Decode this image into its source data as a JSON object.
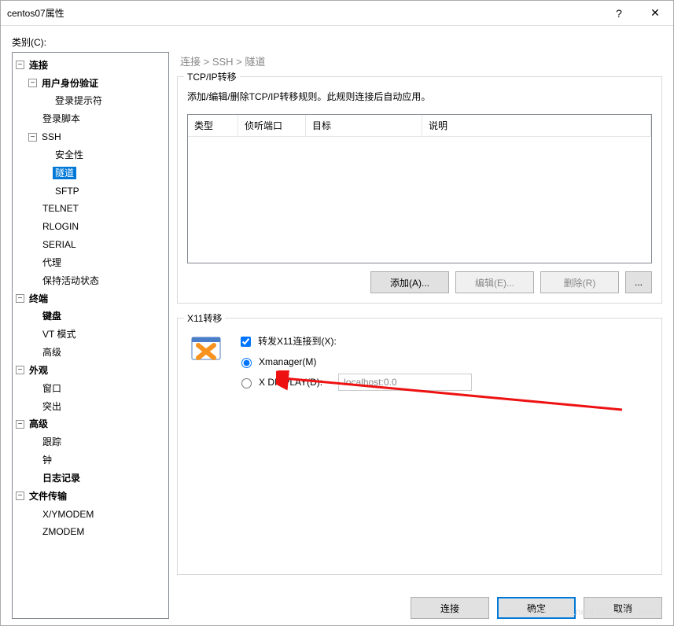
{
  "window": {
    "title": "centos07属性",
    "help": "?",
    "close": "✕"
  },
  "category_label": "类别(C):",
  "tree": {
    "connection": "连接",
    "auth": "用户身份验证",
    "login_prompt": "登录提示符",
    "login_script": "登录脚本",
    "ssh": "SSH",
    "security": "安全性",
    "tunnel": "隧道",
    "sftp": "SFTP",
    "telnet": "TELNET",
    "rlogin": "RLOGIN",
    "serial": "SERIAL",
    "proxy": "代理",
    "keepalive": "保持活动状态",
    "terminal": "终端",
    "keyboard": "键盘",
    "vtmode": "VT 模式",
    "term_adv": "高级",
    "appearance": "外观",
    "window": "窗口",
    "highlight": "突出",
    "advanced": "高级",
    "trace": "跟踪",
    "bell": "钟",
    "logging": "日志记录",
    "filetransfer": "文件传输",
    "xymodem": "X/YMODEM",
    "zmodem": "ZMODEM"
  },
  "breadcrumb": "连接  >  SSH  >  隧道",
  "tcpip": {
    "title": "TCP/IP转移",
    "desc": "添加/编辑/删除TCP/IP转移规则。此规则连接后自动应用。",
    "cols": {
      "type": "类型",
      "port": "侦听端口",
      "target": "目标",
      "desc": "说明"
    },
    "add": "添加(A)...",
    "edit": "编辑(E)...",
    "remove": "删除(R)",
    "more": "..."
  },
  "x11": {
    "title": "X11转移",
    "forward": "转发X11连接到(X):",
    "xmanager": "Xmanager(M)",
    "xdisplay": "X DISPLAY(D):",
    "display_value": "localhost:0.0"
  },
  "footer": {
    "connect": "连接",
    "ok": "确定",
    "cancel": "取消"
  },
  "watermark": "https://blog.csdn.net/LDX2231630401"
}
